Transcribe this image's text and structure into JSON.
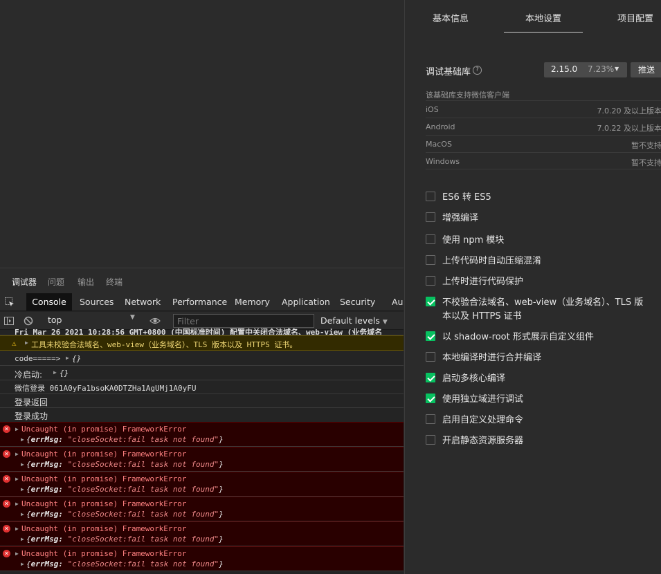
{
  "devtools": {
    "tabs": [
      "调试器",
      "问题",
      "输出",
      "终端"
    ],
    "panel_tabs": [
      "Console",
      "Sources",
      "Network",
      "Performance",
      "Memory",
      "Application",
      "Security",
      "Au"
    ],
    "toolbar": {
      "context": "top",
      "filter_placeholder": "Filter",
      "levels": "Default levels"
    },
    "console": {
      "truncated_line": "Fri Mar 26 2021 10:28:56 GMT+0800 (中国标准时间) 配置中关闭合法域名、web-view (业务域名",
      "warning": "工具未校验合法域名、web-view（业务域名）、TLS 版本以及 HTTPS 证书。",
      "log_lines": [
        {
          "text": "code=====>",
          "obj": "{}"
        },
        {
          "text": "冷启动:",
          "obj": "{}"
        },
        {
          "text": "微信登录 061A0yFa1bsoKA0DTZHa1AgUMj1A0yFU",
          "obj": ""
        },
        {
          "text": "登录返回",
          "obj": ""
        },
        {
          "text": "登录成功",
          "obj": ""
        }
      ],
      "errors": [
        {
          "title": "Uncaught (in promise) FrameworkError",
          "key": "errMsg:",
          "value": "\"closeSocket:fail task not found\""
        },
        {
          "title": "Uncaught (in promise) FrameworkError",
          "key": "errMsg:",
          "value": "\"closeSocket:fail task not found\""
        },
        {
          "title": "Uncaught (in promise) FrameworkError",
          "key": "errMsg:",
          "value": "\"closeSocket:fail task not found\""
        },
        {
          "title": "Uncaught (in promise) FrameworkError",
          "key": "errMsg:",
          "value": "\"closeSocket:fail task not found\""
        },
        {
          "title": "Uncaught (in promise) FrameworkError",
          "key": "errMsg:",
          "value": "\"closeSocket:fail task not found\""
        },
        {
          "title": "Uncaught (in promise) FrameworkError",
          "key": "errMsg:",
          "value": "\"closeSocket:fail task not found\""
        }
      ]
    }
  },
  "settings": {
    "tabs": [
      "基本信息",
      "本地设置",
      "项目配置"
    ],
    "lib_label": "调试基础库",
    "help": "?",
    "version": "2.15.0",
    "version_pct": "7.23%",
    "push_label": "推送",
    "support_title": "该基础库支持微信客户端",
    "support": [
      {
        "name": "iOS",
        "value": "7.0.20 及以上版本"
      },
      {
        "name": "Android",
        "value": "7.0.22 及以上版本"
      },
      {
        "name": "MacOS",
        "value": "暂不支持"
      },
      {
        "name": "Windows",
        "value": "暂不支持"
      }
    ],
    "options": [
      {
        "label": "ES6 转 ES5",
        "checked": false
      },
      {
        "label": "增强编译",
        "checked": false
      },
      {
        "label": "使用 npm 模块",
        "checked": false
      },
      {
        "label": "上传代码时自动压缩混淆",
        "checked": false
      },
      {
        "label": "上传时进行代码保护",
        "checked": false
      },
      {
        "label": "不校验合法域名、web-view（业务域名）、TLS 版本以及 HTTPS 证书",
        "checked": true
      },
      {
        "label": "以 shadow-root 形式展示自定义组件",
        "checked": true
      },
      {
        "label": "本地编译时进行合并编译",
        "checked": false
      },
      {
        "label": "启动多核心编译",
        "checked": true
      },
      {
        "label": "使用独立域进行调试",
        "checked": true
      },
      {
        "label": "启用自定义处理命令",
        "checked": false
      },
      {
        "label": "开启静态资源服务器",
        "checked": false
      }
    ]
  },
  "colors": {
    "checkbox_checked": "#07c160",
    "error_bg": "#290000",
    "warning_bg": "#332b00"
  }
}
